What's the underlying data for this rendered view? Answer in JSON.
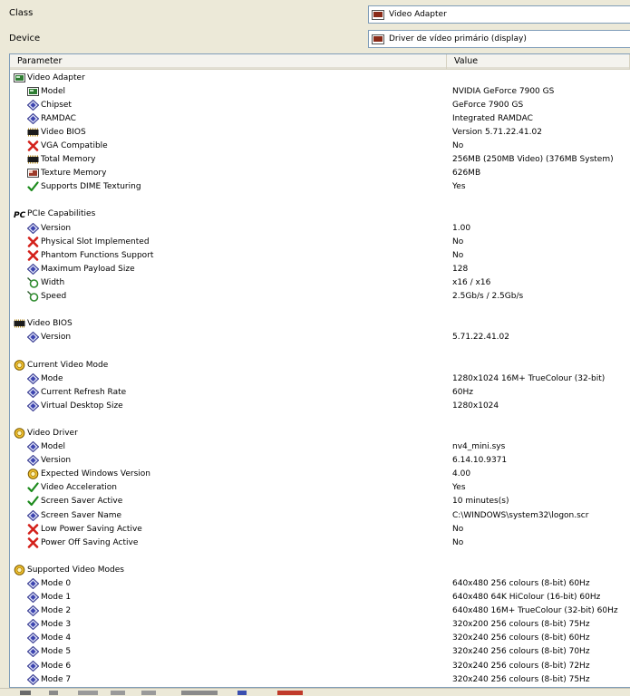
{
  "form": {
    "class_label": "Class",
    "class_value": "Video Adapter",
    "device_label": "Device",
    "device_value": "Driver de vídeo primário (display)"
  },
  "table": {
    "col_parameter": "Parameter",
    "col_value": "Value"
  },
  "rows": [
    {
      "level": 0,
      "icon": "display-adapter-icon",
      "param": "Video Adapter",
      "value": ""
    },
    {
      "level": 1,
      "icon": "display-adapter-icon",
      "param": "Model",
      "value": "NVIDIA GeForce 7900 GS"
    },
    {
      "level": 1,
      "icon": "diamond-property-icon",
      "param": "Chipset",
      "value": "GeForce 7900 GS"
    },
    {
      "level": 1,
      "icon": "diamond-property-icon",
      "param": "RAMDAC",
      "value": "Integrated RAMDAC"
    },
    {
      "level": 1,
      "icon": "memory-chip-icon",
      "param": "Video BIOS",
      "value": "Version 5.71.22.41.02"
    },
    {
      "level": 1,
      "icon": "red-x-icon",
      "param": "VGA Compatible",
      "value": "No"
    },
    {
      "level": 1,
      "icon": "memory-chip-icon",
      "param": "Total Memory",
      "value": "256MB (250MB Video) (376MB System)"
    },
    {
      "level": 1,
      "icon": "texture-icon",
      "param": "Texture Memory",
      "value": "626MB"
    },
    {
      "level": 1,
      "icon": "green-check-icon",
      "param": "Supports DIME Texturing",
      "value": "Yes"
    },
    {
      "level": -1,
      "icon": "",
      "param": "",
      "value": ""
    },
    {
      "level": 0,
      "icon": "pci-logo-icon",
      "param": "PCIe Capabilities",
      "value": ""
    },
    {
      "level": 1,
      "icon": "diamond-property-icon",
      "param": "Version",
      "value": "1.00"
    },
    {
      "level": 1,
      "icon": "red-x-icon",
      "param": "Physical Slot Implemented",
      "value": "No"
    },
    {
      "level": 1,
      "icon": "red-x-icon",
      "param": "Phantom Functions Support",
      "value": "No"
    },
    {
      "level": 1,
      "icon": "diamond-property-icon",
      "param": "Maximum Payload Size",
      "value": "128"
    },
    {
      "level": 1,
      "icon": "connector-icon",
      "param": "Width",
      "value": "x16 / x16"
    },
    {
      "level": 1,
      "icon": "connector-icon",
      "param": "Speed",
      "value": "2.5Gb/s / 2.5Gb/s"
    },
    {
      "level": -1,
      "icon": "",
      "param": "",
      "value": ""
    },
    {
      "level": 0,
      "icon": "memory-chip-icon",
      "param": "Video BIOS",
      "value": ""
    },
    {
      "level": 1,
      "icon": "diamond-property-icon",
      "param": "Version",
      "value": "5.71.22.41.02"
    },
    {
      "level": -1,
      "icon": "",
      "param": "",
      "value": ""
    },
    {
      "level": 0,
      "icon": "yellow-disc-icon",
      "param": "Current Video Mode",
      "value": ""
    },
    {
      "level": 1,
      "icon": "diamond-property-icon",
      "param": "Mode",
      "value": "1280x1024 16M+ TrueColour (32-bit)"
    },
    {
      "level": 1,
      "icon": "diamond-property-icon",
      "param": "Current Refresh Rate",
      "value": "60Hz"
    },
    {
      "level": 1,
      "icon": "diamond-property-icon",
      "param": "Virtual Desktop Size",
      "value": "1280x1024"
    },
    {
      "level": -1,
      "icon": "",
      "param": "",
      "value": ""
    },
    {
      "level": 0,
      "icon": "yellow-disc-icon",
      "param": "Video Driver",
      "value": ""
    },
    {
      "level": 1,
      "icon": "diamond-property-icon",
      "param": "Model",
      "value": "nv4_mini.sys"
    },
    {
      "level": 1,
      "icon": "diamond-property-icon",
      "param": "Version",
      "value": "6.14.10.9371"
    },
    {
      "level": 1,
      "icon": "yellow-disc-icon",
      "param": "Expected Windows Version",
      "value": "4.00"
    },
    {
      "level": 1,
      "icon": "green-check-icon",
      "param": "Video Acceleration",
      "value": "Yes"
    },
    {
      "level": 1,
      "icon": "green-check-icon",
      "param": "Screen Saver Active",
      "value": "10 minutes(s)"
    },
    {
      "level": 1,
      "icon": "diamond-property-icon",
      "param": "Screen Saver Name",
      "value": "C:\\WINDOWS\\system32\\logon.scr"
    },
    {
      "level": 1,
      "icon": "red-x-icon",
      "param": "Low Power Saving Active",
      "value": "No"
    },
    {
      "level": 1,
      "icon": "red-x-icon",
      "param": "Power Off Saving Active",
      "value": "No"
    },
    {
      "level": -1,
      "icon": "",
      "param": "",
      "value": ""
    },
    {
      "level": 0,
      "icon": "yellow-disc-icon",
      "param": "Supported Video Modes",
      "value": ""
    },
    {
      "level": 1,
      "icon": "diamond-property-icon",
      "param": "Mode 0",
      "value": "640x480 256 colours (8-bit) 60Hz"
    },
    {
      "level": 1,
      "icon": "diamond-property-icon",
      "param": "Mode 1",
      "value": "640x480 64K HiColour (16-bit) 60Hz"
    },
    {
      "level": 1,
      "icon": "diamond-property-icon",
      "param": "Mode 2",
      "value": "640x480 16M+ TrueColour (32-bit) 60Hz"
    },
    {
      "level": 1,
      "icon": "diamond-property-icon",
      "param": "Mode 3",
      "value": "320x200 256 colours (8-bit) 75Hz"
    },
    {
      "level": 1,
      "icon": "diamond-property-icon",
      "param": "Mode 4",
      "value": "320x240 256 colours (8-bit) 60Hz"
    },
    {
      "level": 1,
      "icon": "diamond-property-icon",
      "param": "Mode 5",
      "value": "320x240 256 colours (8-bit) 70Hz"
    },
    {
      "level": 1,
      "icon": "diamond-property-icon",
      "param": "Mode 6",
      "value": "320x240 256 colours (8-bit) 72Hz"
    },
    {
      "level": 1,
      "icon": "diamond-property-icon",
      "param": "Mode 7",
      "value": "320x240 256 colours (8-bit) 75Hz"
    }
  ]
}
